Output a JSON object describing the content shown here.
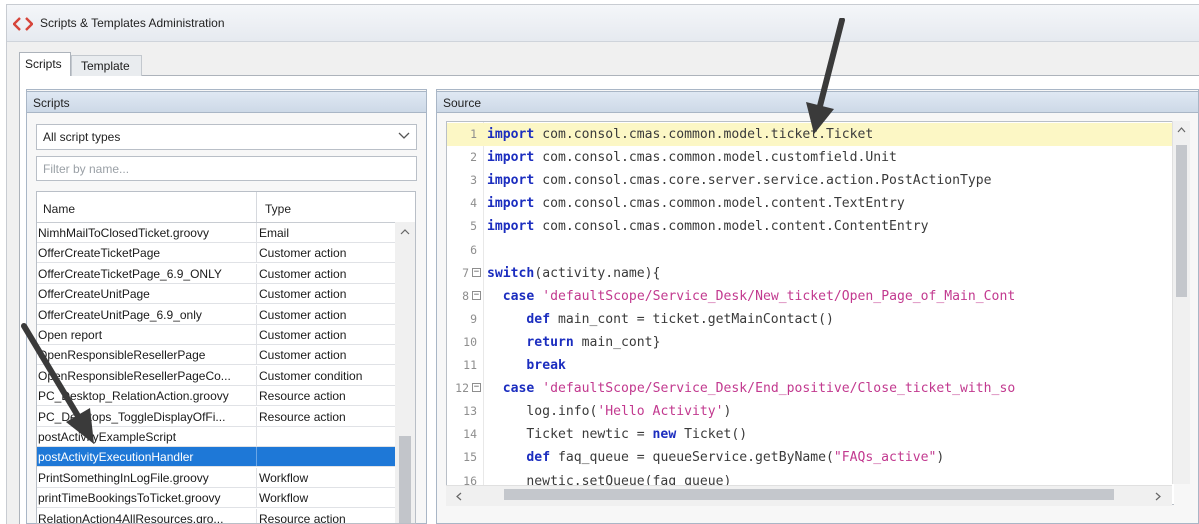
{
  "window": {
    "title": "Scripts & Templates Administration",
    "icon": "code-brackets-icon",
    "accent": "#d6453a"
  },
  "tabs": [
    {
      "label": "Scripts",
      "selected": true
    },
    {
      "label": "Template",
      "selected": false
    }
  ],
  "scripts_panel": {
    "header": "Scripts",
    "type_select": {
      "value": "All script types",
      "icon": "chevron-down-icon"
    },
    "filter": {
      "placeholder": "Filter by name...",
      "value": ""
    },
    "columns": [
      "Name",
      "Type"
    ],
    "rows": [
      {
        "name": "NimhMailToClosedTicket.groovy",
        "type": "Email"
      },
      {
        "name": "OfferCreateTicketPage",
        "type": "Customer action"
      },
      {
        "name": "OfferCreateTicketPage_6.9_ONLY",
        "type": "Customer action"
      },
      {
        "name": "OfferCreateUnitPage",
        "type": "Customer action"
      },
      {
        "name": "OfferCreateUnitPage_6.9_only",
        "type": "Customer action"
      },
      {
        "name": "Open report",
        "type": "Customer action"
      },
      {
        "name": "OpenResponsibleResellerPage",
        "type": "Customer action"
      },
      {
        "name": "OpenResponsibleResellerPageCo...",
        "type": "Customer condition"
      },
      {
        "name": "PC_Desktop_RelationAction.groovy",
        "type": "Resource action"
      },
      {
        "name": "PC_Desktops_ToggleDisplayOfFi...",
        "type": "Resource action"
      },
      {
        "name": "postActivityExampleScript",
        "type": ""
      },
      {
        "name": "postActivityExecutionHandler",
        "type": "",
        "selected": true
      },
      {
        "name": "PrintSomethingInLogFile.groovy",
        "type": "Workflow"
      },
      {
        "name": "printTimeBookingsToTicket.groovy",
        "type": "Workflow"
      },
      {
        "name": "RelationAction4AllResources.gro...",
        "type": "Resource action"
      }
    ],
    "selected_color": "#1e78d7"
  },
  "source_panel": {
    "header": "Source",
    "lines": [
      {
        "n": "1",
        "hl": true,
        "fold": false,
        "segments": [
          {
            "t": "import",
            "c": "kw"
          },
          {
            "t": " com.consol.cmas.common.model.ticket.Ticket"
          }
        ]
      },
      {
        "n": "2",
        "fold": false,
        "segments": [
          {
            "t": "import",
            "c": "kw"
          },
          {
            "t": " com.consol.cmas.common.model.customfield.Unit"
          }
        ]
      },
      {
        "n": "3",
        "fold": false,
        "segments": [
          {
            "t": "import",
            "c": "kw"
          },
          {
            "t": " com.consol.cmas.core.server.service.action.PostActionType"
          }
        ]
      },
      {
        "n": "4",
        "fold": false,
        "segments": [
          {
            "t": "import",
            "c": "kw"
          },
          {
            "t": " com.consol.cmas.common.model.content.TextEntry"
          }
        ]
      },
      {
        "n": "5",
        "fold": false,
        "segments": [
          {
            "t": "import",
            "c": "kw"
          },
          {
            "t": " com.consol.cmas.common.model.content.ContentEntry"
          }
        ]
      },
      {
        "n": "6",
        "fold": false,
        "segments": [
          {
            "t": ""
          }
        ]
      },
      {
        "n": "7",
        "fold": true,
        "segments": [
          {
            "t": "switch",
            "c": "kw"
          },
          {
            "t": "(activity.name){"
          }
        ]
      },
      {
        "n": "8",
        "fold": true,
        "segments": [
          {
            "t": "  "
          },
          {
            "t": "case",
            "c": "kw"
          },
          {
            "t": " "
          },
          {
            "t": "'defaultScope/Service_Desk/New_ticket/Open_Page_of_Main_Cont",
            "c": "str"
          }
        ]
      },
      {
        "n": "9",
        "fold": false,
        "segments": [
          {
            "t": "     "
          },
          {
            "t": "def",
            "c": "kw"
          },
          {
            "t": " main_cont = ticket.getMainContact()"
          }
        ]
      },
      {
        "n": "10",
        "fold": false,
        "segments": [
          {
            "t": "     "
          },
          {
            "t": "return",
            "c": "kw"
          },
          {
            "t": " main_cont}"
          }
        ]
      },
      {
        "n": "11",
        "fold": false,
        "segments": [
          {
            "t": "     "
          },
          {
            "t": "break",
            "c": "kw"
          }
        ]
      },
      {
        "n": "12",
        "fold": true,
        "segments": [
          {
            "t": "  "
          },
          {
            "t": "case",
            "c": "kw"
          },
          {
            "t": " "
          },
          {
            "t": "'defaultScope/Service_Desk/End_positive/Close_ticket_with_so",
            "c": "str"
          }
        ]
      },
      {
        "n": "13",
        "fold": false,
        "segments": [
          {
            "t": "     log.info("
          },
          {
            "t": "'Hello Activity'",
            "c": "str"
          },
          {
            "t": ")"
          }
        ]
      },
      {
        "n": "14",
        "fold": false,
        "segments": [
          {
            "t": "     Ticket newtic = "
          },
          {
            "t": "new",
            "c": "kw"
          },
          {
            "t": " Ticket()"
          }
        ]
      },
      {
        "n": "15",
        "fold": false,
        "segments": [
          {
            "t": "     "
          },
          {
            "t": "def",
            "c": "kw"
          },
          {
            "t": " faq_queue = queueService.getByName("
          },
          {
            "t": "\"FAQs_active\"",
            "c": "str"
          },
          {
            "t": ")"
          }
        ]
      },
      {
        "n": "16",
        "fold": false,
        "segments": [
          {
            "t": "     newtic.setQueue(faq_queue)"
          }
        ]
      }
    ]
  },
  "annotations": {
    "arrow_color": "#3a3a3a"
  }
}
